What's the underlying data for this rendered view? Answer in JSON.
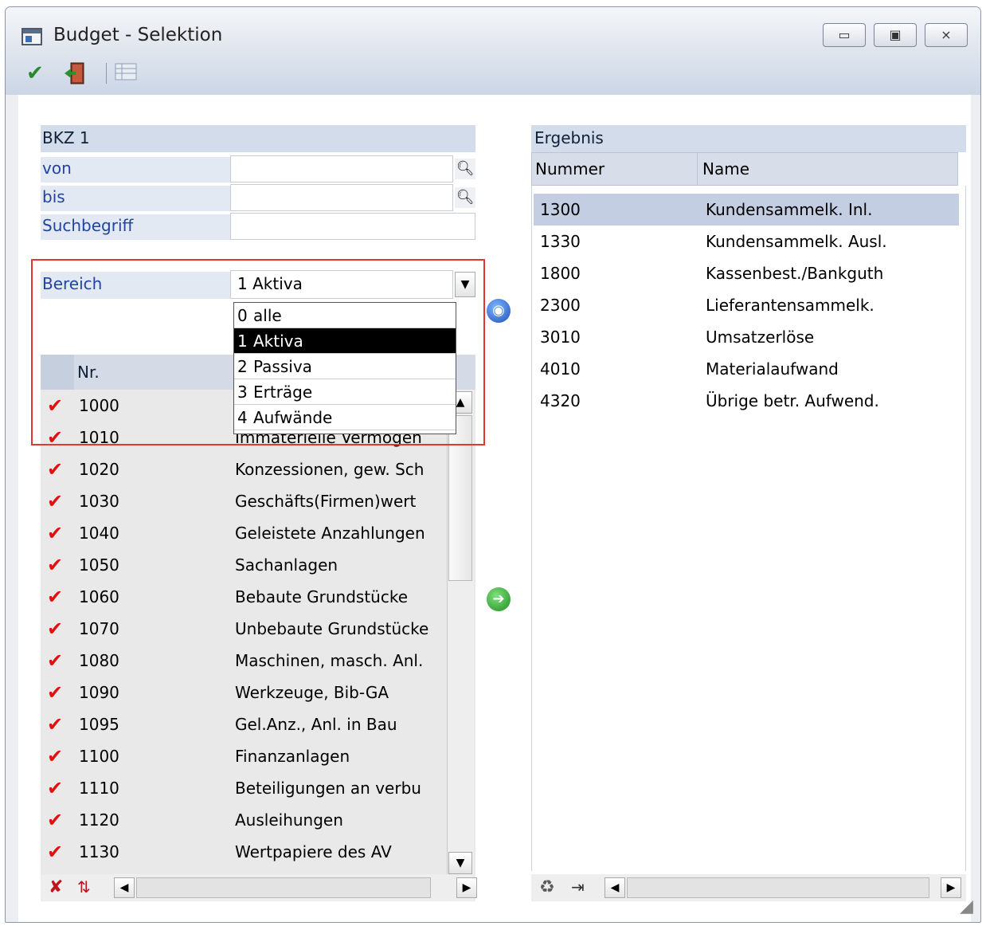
{
  "window": {
    "title": "Budget - Selektion",
    "controls": [
      "▭",
      "▣",
      "⨯"
    ]
  },
  "toolbar": {
    "ok_icon": "checkmark-icon",
    "exit_icon": "exit-door-icon",
    "grid_icon": "table-icon"
  },
  "filter": {
    "header": "BKZ 1",
    "von_label": "von",
    "von_value": "",
    "bis_label": "bis",
    "bis_value": "",
    "suchbegriff_label": "Suchbegriff",
    "suchbegriff_value": "",
    "bereich_label": "Bereich",
    "bereich_value": "1 Aktiva"
  },
  "dropdown": {
    "options": [
      {
        "key": "0",
        "label": "alle"
      },
      {
        "key": "1",
        "label": "Aktiva"
      },
      {
        "key": "2",
        "label": "Passiva"
      },
      {
        "key": "3",
        "label": "Erträge"
      },
      {
        "key": "4",
        "label": "Aufwände"
      }
    ],
    "selected": "1"
  },
  "left_grid": {
    "col_nr": "Nr.",
    "rows": [
      {
        "nr": "1000",
        "name": "",
        "checked": true
      },
      {
        "nr": "1010",
        "name": "Immaterielle Vermögen",
        "checked": true
      },
      {
        "nr": "1020",
        "name": "Konzessionen, gew. Sch",
        "checked": true
      },
      {
        "nr": "1030",
        "name": "Geschäfts(Firmen)wert",
        "checked": true
      },
      {
        "nr": "1040",
        "name": "Geleistete Anzahlungen",
        "checked": true
      },
      {
        "nr": "1050",
        "name": "Sachanlagen",
        "checked": true
      },
      {
        "nr": "1060",
        "name": "Bebaute Grundstücke",
        "checked": true
      },
      {
        "nr": "1070",
        "name": "Unbebaute Grundstücke",
        "checked": true
      },
      {
        "nr": "1080",
        "name": "Maschinen, masch. Anl.",
        "checked": true
      },
      {
        "nr": "1090",
        "name": "Werkzeuge, Bib-GA",
        "checked": true
      },
      {
        "nr": "1095",
        "name": "Gel.Anz., Anl. in Bau",
        "checked": true
      },
      {
        "nr": "1100",
        "name": "Finanzanlagen",
        "checked": true
      },
      {
        "nr": "1110",
        "name": "Beteiligungen an verbu",
        "checked": true
      },
      {
        "nr": "1120",
        "name": "Ausleihungen",
        "checked": true
      },
      {
        "nr": "1130",
        "name": "Wertpapiere des AV",
        "checked": true
      }
    ]
  },
  "result": {
    "header": "Ergebnis",
    "col_nummer": "Nummer",
    "col_name": "Name",
    "rows": [
      {
        "nummer": "1300",
        "name": "Kundensammelk. Inl.",
        "selected": true
      },
      {
        "nummer": "1330",
        "name": "Kundensammelk. Ausl."
      },
      {
        "nummer": "1800",
        "name": "Kassenbest./Bankguth"
      },
      {
        "nummer": "2300",
        "name": "Lieferantensammelk."
      },
      {
        "nummer": "3010",
        "name": "Umsatzerlöse"
      },
      {
        "nummer": "4010",
        "name": "Materialaufwand"
      },
      {
        "nummer": "4320",
        "name": "Übrige betr. Aufwend."
      }
    ]
  },
  "colors": {
    "accent": "#2343a0",
    "selection": "#c3cee2",
    "red_highlight": "#e53535"
  }
}
